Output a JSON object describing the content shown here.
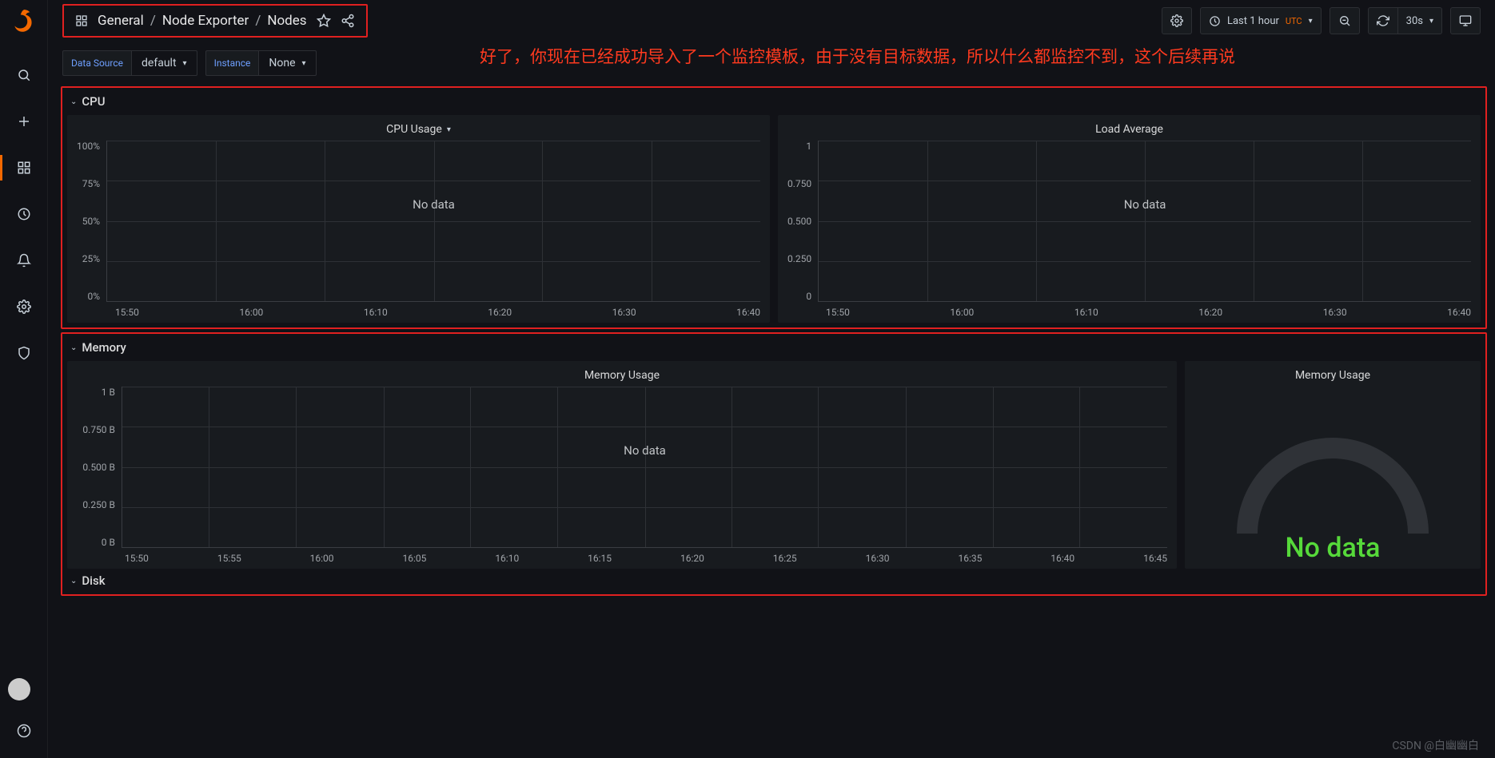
{
  "breadcrumb": {
    "folder": "General",
    "dashboard": "Node Exporter",
    "page": "Nodes"
  },
  "annotation_text": "好了，你现在已经成功导入了一个监控模板，由于没有目标数据，所以什么都监控不到，这个后续再说",
  "watermark": "CSDN @白幽幽白",
  "toolbar": {
    "time_range": "Last 1 hour",
    "time_zone": "UTC",
    "refresh_interval": "30s"
  },
  "variables": {
    "data_source_label": "Data Source",
    "data_source_value": "default",
    "instance_label": "Instance",
    "instance_value": "None"
  },
  "rows": {
    "cpu": {
      "title": "CPU"
    },
    "memory": {
      "title": "Memory"
    },
    "disk": {
      "title": "Disk"
    }
  },
  "labels": {
    "no_data": "No data"
  },
  "chart_data": [
    {
      "id": "cpu_usage",
      "title": "CPU Usage",
      "type": "line",
      "y_ticks": [
        "100%",
        "75%",
        "50%",
        "25%",
        "0%"
      ],
      "x_ticks": [
        "15:50",
        "16:00",
        "16:10",
        "16:20",
        "16:30",
        "16:40"
      ],
      "ylim": [
        0,
        100
      ],
      "series": [],
      "no_data": true
    },
    {
      "id": "load_average",
      "title": "Load Average",
      "type": "line",
      "y_ticks": [
        "1",
        "0.750",
        "0.500",
        "0.250",
        "0"
      ],
      "x_ticks": [
        "15:50",
        "16:00",
        "16:10",
        "16:20",
        "16:30",
        "16:40"
      ],
      "ylim": [
        0,
        1
      ],
      "series": [],
      "no_data": true
    },
    {
      "id": "memory_usage_ts",
      "title": "Memory Usage",
      "type": "line",
      "y_ticks": [
        "1 B",
        "0.750 B",
        "0.500 B",
        "0.250 B",
        "0 B"
      ],
      "x_ticks": [
        "15:50",
        "15:55",
        "16:00",
        "16:05",
        "16:10",
        "16:15",
        "16:20",
        "16:25",
        "16:30",
        "16:35",
        "16:40",
        "16:45"
      ],
      "ylim": [
        0,
        1
      ],
      "series": [],
      "no_data": true
    },
    {
      "id": "memory_usage_gauge",
      "title": "Memory Usage",
      "type": "gauge",
      "value": null,
      "display": "No data",
      "no_data": true
    }
  ]
}
